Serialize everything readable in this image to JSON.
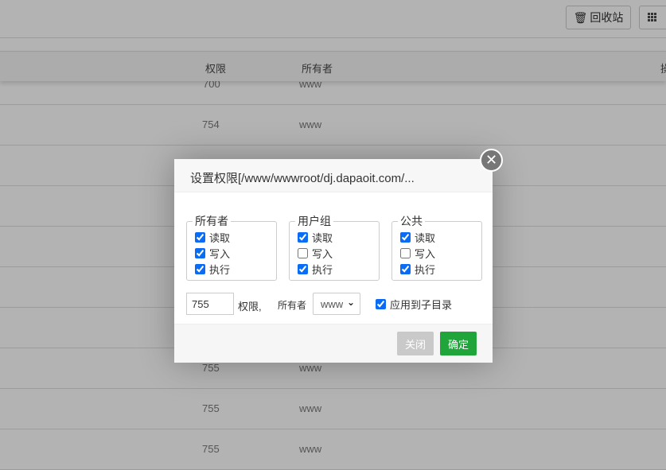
{
  "toolbar": {
    "recycle_label": "回收站"
  },
  "table": {
    "headers": {
      "permission": "权限",
      "owner": "所有者",
      "ops": "操"
    },
    "rows": [
      {
        "perm": "700",
        "owner": "www"
      },
      {
        "perm": "754",
        "owner": "www"
      },
      {
        "perm": "755",
        "owner": "www"
      },
      {
        "perm": "755",
        "owner": "www"
      },
      {
        "perm": "755",
        "owner": "www"
      }
    ]
  },
  "dialog": {
    "title": "设置权限[/www/wwwroot/dj.dapaoit.com/...",
    "groups": [
      {
        "label": "所有者",
        "read": "读取",
        "write": "写入",
        "exec": "执行",
        "read_checked": true,
        "write_checked": true,
        "exec_checked": true
      },
      {
        "label": "用户组",
        "read": "读取",
        "write": "写入",
        "exec": "执行",
        "read_checked": true,
        "write_checked": false,
        "exec_checked": true
      },
      {
        "label": "公共",
        "read": "读取",
        "write": "写入",
        "exec": "执行",
        "read_checked": true,
        "write_checked": false,
        "exec_checked": true
      }
    ],
    "perm_value": "755",
    "perm_label": "权限,",
    "owner_label": "所有者",
    "owner_value": "www",
    "apply_sub_label": "应用到子目录",
    "apply_sub_checked": true,
    "close_label": "关闭",
    "confirm_label": "确定"
  }
}
